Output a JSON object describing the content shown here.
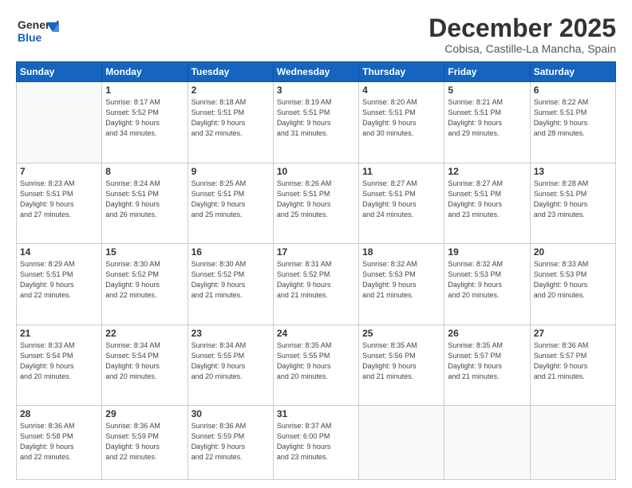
{
  "header": {
    "logo_line1": "General",
    "logo_line2": "Blue",
    "title": "December 2025",
    "subtitle": "Cobisa, Castille-La Mancha, Spain"
  },
  "days_of_week": [
    "Sunday",
    "Monday",
    "Tuesday",
    "Wednesday",
    "Thursday",
    "Friday",
    "Saturday"
  ],
  "weeks": [
    [
      {
        "day": "",
        "info": ""
      },
      {
        "day": "1",
        "info": "Sunrise: 8:17 AM\nSunset: 5:52 PM\nDaylight: 9 hours\nand 34 minutes."
      },
      {
        "day": "2",
        "info": "Sunrise: 8:18 AM\nSunset: 5:51 PM\nDaylight: 9 hours\nand 32 minutes."
      },
      {
        "day": "3",
        "info": "Sunrise: 8:19 AM\nSunset: 5:51 PM\nDaylight: 9 hours\nand 31 minutes."
      },
      {
        "day": "4",
        "info": "Sunrise: 8:20 AM\nSunset: 5:51 PM\nDaylight: 9 hours\nand 30 minutes."
      },
      {
        "day": "5",
        "info": "Sunrise: 8:21 AM\nSunset: 5:51 PM\nDaylight: 9 hours\nand 29 minutes."
      },
      {
        "day": "6",
        "info": "Sunrise: 8:22 AM\nSunset: 5:51 PM\nDaylight: 9 hours\nand 28 minutes."
      }
    ],
    [
      {
        "day": "7",
        "info": "Sunrise: 8:23 AM\nSunset: 5:51 PM\nDaylight: 9 hours\nand 27 minutes."
      },
      {
        "day": "8",
        "info": "Sunrise: 8:24 AM\nSunset: 5:51 PM\nDaylight: 9 hours\nand 26 minutes."
      },
      {
        "day": "9",
        "info": "Sunrise: 8:25 AM\nSunset: 5:51 PM\nDaylight: 9 hours\nand 25 minutes."
      },
      {
        "day": "10",
        "info": "Sunrise: 8:26 AM\nSunset: 5:51 PM\nDaylight: 9 hours\nand 25 minutes."
      },
      {
        "day": "11",
        "info": "Sunrise: 8:27 AM\nSunset: 5:51 PM\nDaylight: 9 hours\nand 24 minutes."
      },
      {
        "day": "12",
        "info": "Sunrise: 8:27 AM\nSunset: 5:51 PM\nDaylight: 9 hours\nand 23 minutes."
      },
      {
        "day": "13",
        "info": "Sunrise: 8:28 AM\nSunset: 5:51 PM\nDaylight: 9 hours\nand 23 minutes."
      }
    ],
    [
      {
        "day": "14",
        "info": "Sunrise: 8:29 AM\nSunset: 5:51 PM\nDaylight: 9 hours\nand 22 minutes."
      },
      {
        "day": "15",
        "info": "Sunrise: 8:30 AM\nSunset: 5:52 PM\nDaylight: 9 hours\nand 22 minutes."
      },
      {
        "day": "16",
        "info": "Sunrise: 8:30 AM\nSunset: 5:52 PM\nDaylight: 9 hours\nand 21 minutes."
      },
      {
        "day": "17",
        "info": "Sunrise: 8:31 AM\nSunset: 5:52 PM\nDaylight: 9 hours\nand 21 minutes."
      },
      {
        "day": "18",
        "info": "Sunrise: 8:32 AM\nSunset: 5:53 PM\nDaylight: 9 hours\nand 21 minutes."
      },
      {
        "day": "19",
        "info": "Sunrise: 8:32 AM\nSunset: 5:53 PM\nDaylight: 9 hours\nand 20 minutes."
      },
      {
        "day": "20",
        "info": "Sunrise: 8:33 AM\nSunset: 5:53 PM\nDaylight: 9 hours\nand 20 minutes."
      }
    ],
    [
      {
        "day": "21",
        "info": "Sunrise: 8:33 AM\nSunset: 5:54 PM\nDaylight: 9 hours\nand 20 minutes."
      },
      {
        "day": "22",
        "info": "Sunrise: 8:34 AM\nSunset: 5:54 PM\nDaylight: 9 hours\nand 20 minutes."
      },
      {
        "day": "23",
        "info": "Sunrise: 8:34 AM\nSunset: 5:55 PM\nDaylight: 9 hours\nand 20 minutes."
      },
      {
        "day": "24",
        "info": "Sunrise: 8:35 AM\nSunset: 5:55 PM\nDaylight: 9 hours\nand 20 minutes."
      },
      {
        "day": "25",
        "info": "Sunrise: 8:35 AM\nSunset: 5:56 PM\nDaylight: 9 hours\nand 21 minutes."
      },
      {
        "day": "26",
        "info": "Sunrise: 8:35 AM\nSunset: 5:57 PM\nDaylight: 9 hours\nand 21 minutes."
      },
      {
        "day": "27",
        "info": "Sunrise: 8:36 AM\nSunset: 5:57 PM\nDaylight: 9 hours\nand 21 minutes."
      }
    ],
    [
      {
        "day": "28",
        "info": "Sunrise: 8:36 AM\nSunset: 5:58 PM\nDaylight: 9 hours\nand 22 minutes."
      },
      {
        "day": "29",
        "info": "Sunrise: 8:36 AM\nSunset: 5:59 PM\nDaylight: 9 hours\nand 22 minutes."
      },
      {
        "day": "30",
        "info": "Sunrise: 8:36 AM\nSunset: 5:59 PM\nDaylight: 9 hours\nand 22 minutes."
      },
      {
        "day": "31",
        "info": "Sunrise: 8:37 AM\nSunset: 6:00 PM\nDaylight: 9 hours\nand 23 minutes."
      },
      {
        "day": "",
        "info": ""
      },
      {
        "day": "",
        "info": ""
      },
      {
        "day": "",
        "info": ""
      }
    ]
  ]
}
